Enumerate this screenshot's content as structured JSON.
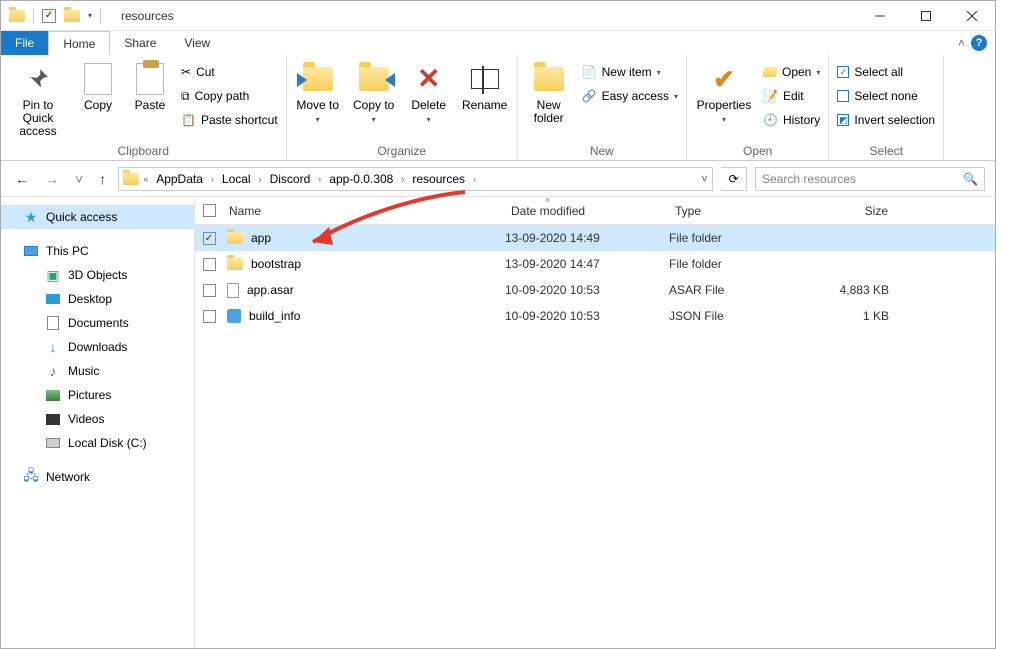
{
  "window": {
    "title": "resources",
    "qat_down_label": "▾"
  },
  "menu": {
    "file": "File",
    "home": "Home",
    "share": "Share",
    "view": "View"
  },
  "ribbon": {
    "clipboard": {
      "pin": "Pin to Quick access",
      "copy": "Copy",
      "paste": "Paste",
      "cut": "Cut",
      "copy_path": "Copy path",
      "paste_shortcut": "Paste shortcut",
      "group": "Clipboard"
    },
    "organize": {
      "move_to": "Move to",
      "copy_to": "Copy to",
      "delete": "Delete",
      "rename": "Rename",
      "group": "Organize"
    },
    "new": {
      "new_folder": "New folder",
      "new_item": "New item",
      "easy_access": "Easy access",
      "group": "New"
    },
    "open": {
      "properties": "Properties",
      "open": "Open",
      "edit": "Edit",
      "history": "History",
      "group": "Open"
    },
    "select": {
      "select_all": "Select all",
      "select_none": "Select none",
      "invert": "Invert selection",
      "group": "Select"
    }
  },
  "breadcrumb": {
    "overflow": "«",
    "items": [
      "AppData",
      "Local",
      "Discord",
      "app-0.0.308",
      "resources"
    ]
  },
  "search": {
    "placeholder": "Search resources"
  },
  "sidebar": {
    "quick_access": "Quick access",
    "this_pc": "This PC",
    "objects3d": "3D Objects",
    "desktop": "Desktop",
    "documents": "Documents",
    "downloads": "Downloads",
    "music": "Music",
    "pictures": "Pictures",
    "videos": "Videos",
    "localdisk": "Local Disk (C:)",
    "network": "Network"
  },
  "columns": {
    "name": "Name",
    "date": "Date modified",
    "type": "Type",
    "size": "Size"
  },
  "files": [
    {
      "name": "app",
      "date": "13-09-2020 14:49",
      "type": "File folder",
      "size": "",
      "icon": "folder",
      "selected": true
    },
    {
      "name": "bootstrap",
      "date": "13-09-2020 14:47",
      "type": "File folder",
      "size": "",
      "icon": "folder",
      "selected": false
    },
    {
      "name": "app.asar",
      "date": "10-09-2020 10:53",
      "type": "ASAR File",
      "size": "4,883 KB",
      "icon": "file",
      "selected": false
    },
    {
      "name": "build_info",
      "date": "10-09-2020 10:53",
      "type": "JSON File",
      "size": "1 KB",
      "icon": "json",
      "selected": false
    }
  ]
}
